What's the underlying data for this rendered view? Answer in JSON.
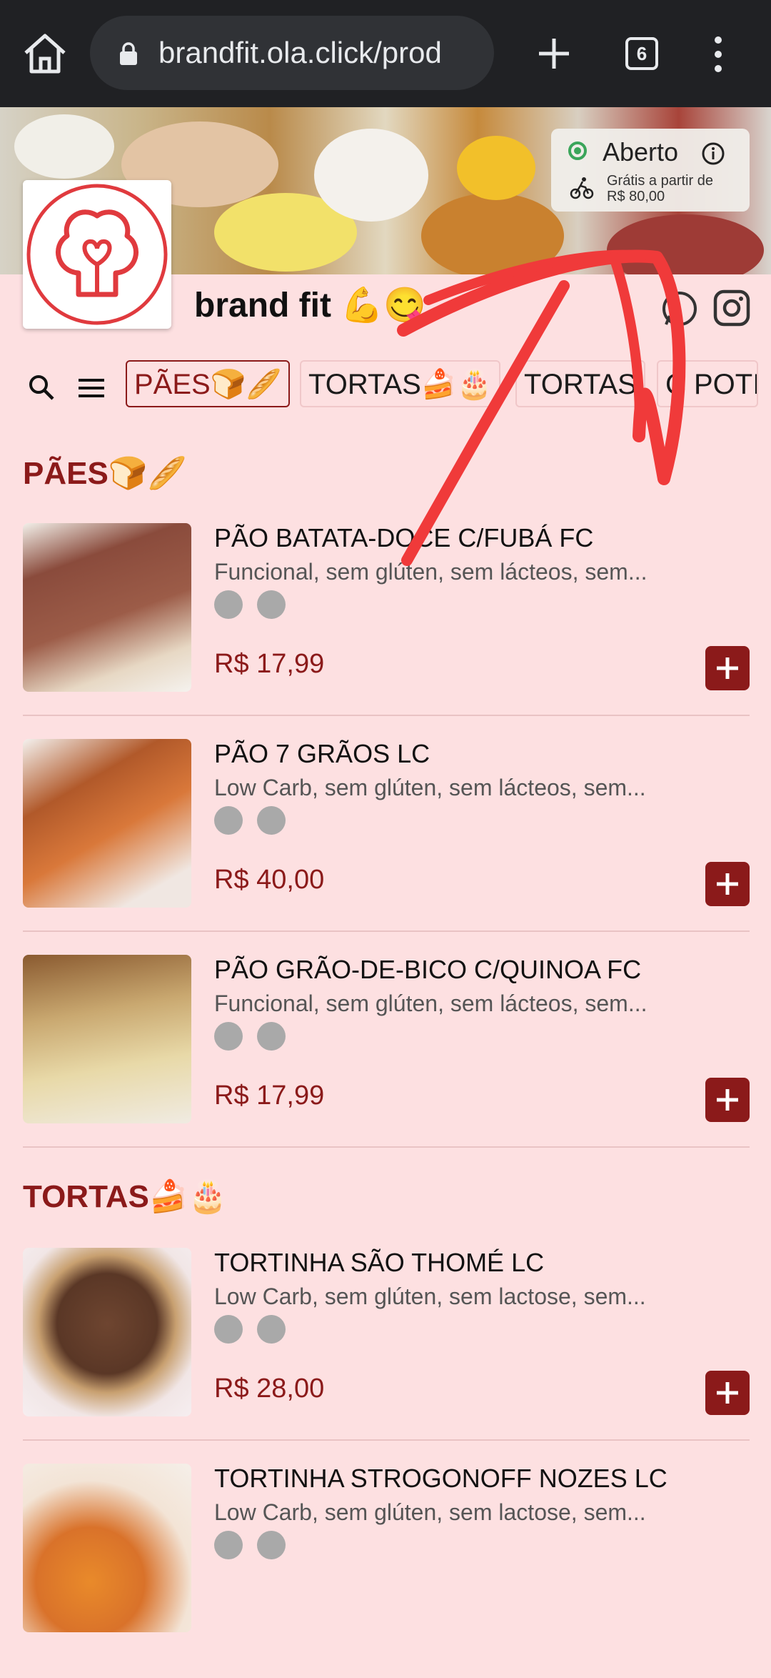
{
  "browser": {
    "url": "brandfit.ola.click/prod",
    "tab_count": "6"
  },
  "store": {
    "name": "brand fit",
    "name_emoji": "💪😋",
    "status": "Aberto",
    "delivery_line1": "Grátis a partir de",
    "delivery_line2": "R$ 80,00"
  },
  "categories": [
    "PÃES🍞🥖",
    "TORTAS🍰🎂",
    "TORTAS",
    "C POTI"
  ],
  "sections": [
    {
      "title": "PÃES🍞🥖",
      "products": [
        {
          "name": "PÃO BATATA-DOCE C/FUBÁ FC",
          "desc": "Funcional, sem glúten, sem lácteos, sem...",
          "price": "R$ 17,99"
        },
        {
          "name": "PÃO 7 GRÃOS LC",
          "desc": "Low Carb, sem glúten, sem lácteos, sem...",
          "price": "R$ 40,00"
        },
        {
          "name": "PÃO GRÃO-DE-BICO C/QUINOA FC",
          "desc": "Funcional, sem glúten, sem lácteos, sem...",
          "price": "R$ 17,99"
        }
      ]
    },
    {
      "title": "TORTAS🍰🎂",
      "products": [
        {
          "name": "TORTINHA SÃO THOMÉ LC",
          "desc": "Low Carb, sem glúten, sem lactose, sem...",
          "price": "R$ 28,00"
        },
        {
          "name": "TORTINHA STROGONOFF NOZES LC",
          "desc": "Low Carb, sem glúten, sem lactose, sem..."
        }
      ]
    }
  ],
  "colors": {
    "accent": "#8b1a1a",
    "background": "#fde0e1",
    "annotation": "#f03a3a",
    "open_status": "#3aa55a"
  }
}
